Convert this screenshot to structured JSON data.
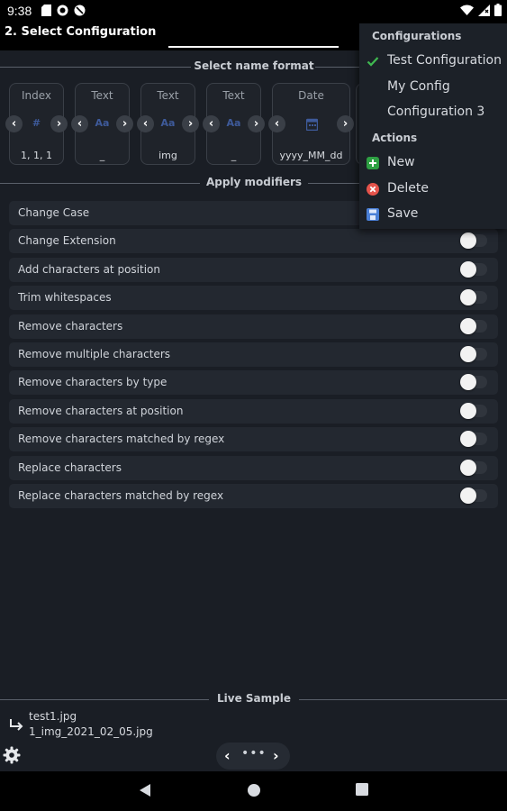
{
  "status_bar": {
    "time": "9:38"
  },
  "app_bar": {
    "title": "2. Select Configuration"
  },
  "name_format": {
    "header": "Select name format",
    "cards": [
      {
        "type": "Index",
        "icon": "#",
        "value": "1, 1, 1"
      },
      {
        "type": "Text",
        "icon": "Aa",
        "value": "_"
      },
      {
        "type": "Text",
        "icon": "Aa",
        "value": "img"
      },
      {
        "type": "Text",
        "icon": "Aa",
        "value": "_"
      },
      {
        "type": "Date",
        "icon": "calendar-icon",
        "value": "yyyy_MM_dd"
      }
    ]
  },
  "modifiers": {
    "header": "Apply modifiers",
    "items": [
      "Change Case",
      "Change Extension",
      "Add characters at position",
      "Trim whitespaces",
      "Remove characters",
      "Remove multiple characters",
      "Remove characters by type",
      "Remove characters at position",
      "Remove characters matched by regex",
      "Replace characters",
      "Replace characters matched by regex"
    ]
  },
  "menu": {
    "configurations_header": "Configurations",
    "configurations": [
      "Test Configuration",
      "My Config",
      "Configuration 3"
    ],
    "selected_configuration": "Test Configuration",
    "actions_header": "Actions",
    "actions": [
      "New",
      "Delete",
      "Save"
    ]
  },
  "live_sample": {
    "header": "Live Sample",
    "original": "test1.jpg",
    "renamed": "1_img_2021_02_05.jpg"
  },
  "colors": {
    "background": "#1a1e25",
    "check_green": "#3fb950",
    "new_green": "#2ea043",
    "delete_red": "#e5534b",
    "save_blue": "#4a7fd6"
  }
}
